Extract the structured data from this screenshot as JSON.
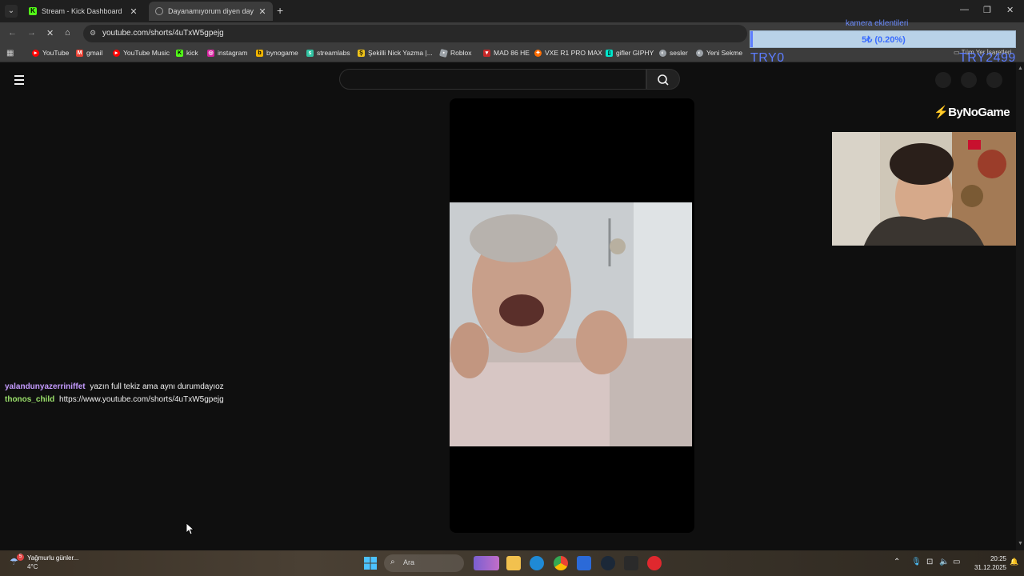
{
  "tabs": [
    {
      "label": "Stream - Kick Dashboard",
      "icon": "kick-icon"
    },
    {
      "label": "Dayanamıyorum diyen day",
      "icon": "youtube-loading-icon"
    }
  ],
  "address_bar": {
    "url": "youtube.com/shorts/4uTxW5gpejg"
  },
  "bookmarks": [
    {
      "label": "YouTube",
      "icon": "youtube-icon",
      "color": "#ff0000"
    },
    {
      "label": "gmail",
      "icon": "gmail-icon",
      "color": "#ea4335"
    },
    {
      "label": "YouTube Music",
      "icon": "youtube-music-icon",
      "color": "#ff0000"
    },
    {
      "label": "kick",
      "icon": "kick-icon",
      "color": "#53fc18"
    },
    {
      "label": "instagram",
      "icon": "instagram-icon",
      "color": "#d6249f"
    },
    {
      "label": "bynogame",
      "icon": "bynogame-icon",
      "color": "#f0b400"
    },
    {
      "label": "streamlabs",
      "icon": "streamlabs-icon",
      "color": "#31c3a2"
    },
    {
      "label": "Şekilli Nick Yazma |...",
      "icon": "nick-icon",
      "color": "#f0c419"
    },
    {
      "label": "Roblox",
      "icon": "roblox-icon",
      "color": "#9aa0a6"
    },
    {
      "label": "MAD 86 HE",
      "icon": "mad-icon",
      "color": "#c62828"
    },
    {
      "label": "VXE R1 PRO MAX",
      "icon": "vxe-icon",
      "color": "#ff6d00"
    },
    {
      "label": "gifler GIPHY",
      "icon": "giphy-icon",
      "color": "#00e6cc"
    },
    {
      "label": "sesler",
      "icon": "globe-icon",
      "color": "#9aa0a6"
    },
    {
      "label": "Yeni Sekme",
      "icon": "globe-icon",
      "color": "#9aa0a6"
    }
  ],
  "all_bookmarks_label": "Tüm Yer İşaretleri",
  "overlay": {
    "label": "kamera eklentileri",
    "progress_text": "5₺ (0.20%)",
    "progress_fraction": 0.002,
    "left_name": "TRY0",
    "right_name": "TRY2499"
  },
  "chat": [
    {
      "user": "yalandunyazerriniffet",
      "message": "yazın full tekiz ama aynı durumdayıoz",
      "color": "#c59bff"
    },
    {
      "user": "thonos_child",
      "message": "https://www.youtube.com/shorts/4uTxW5gpejg",
      "color": "#9be16b"
    }
  ],
  "brand": {
    "logo": "ByNoGame"
  },
  "taskbar": {
    "weather_text": "Yağmurlu günler...",
    "temperature": "4°C",
    "badge": "5",
    "search_label": "Ara",
    "time": "20:25",
    "date": "31.12.2025"
  }
}
